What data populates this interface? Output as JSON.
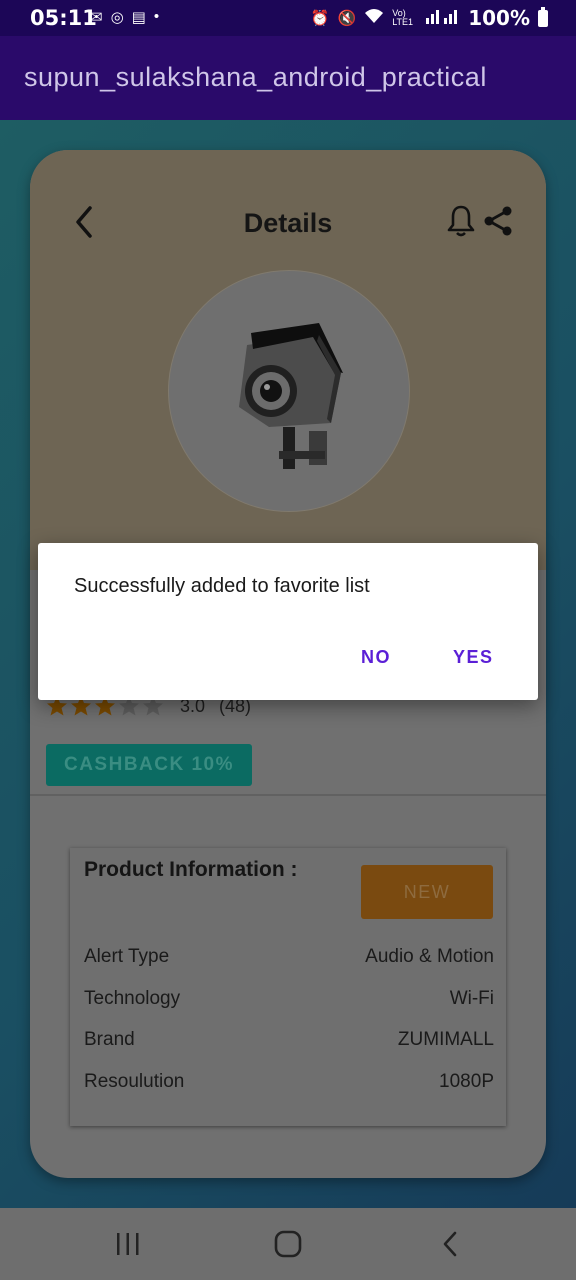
{
  "status_bar": {
    "time": "05:11",
    "battery": "100%",
    "network": "Vo) LTE1"
  },
  "app_bar": {
    "title": "supun_sulakshana_android_practical"
  },
  "details": {
    "title": "Details",
    "rating": {
      "value": "3.0",
      "count": "(48)",
      "stars_filled": 3,
      "stars_total": 5
    },
    "cashback_label": "CASHBACK 10%",
    "product_info": {
      "title": "Product Information :",
      "badge": "NEW",
      "rows": [
        {
          "key": "Alert Type",
          "value": "Audio & Motion"
        },
        {
          "key": "Technology",
          "value": "Wi-Fi"
        },
        {
          "key": "Brand",
          "value": "ZUMIMALL"
        },
        {
          "key": "Resoulution",
          "value": "1080P"
        }
      ]
    }
  },
  "dialog": {
    "message": "Successfully added to favorite list",
    "no_label": "NO",
    "yes_label": "YES"
  },
  "colors": {
    "app_bar": "#2a0a6a",
    "status_bar": "#1c0657",
    "dialog_accent": "#5b1fd6",
    "star_filled": "#7a4a00"
  },
  "icons": [
    "back-arrow-icon",
    "bell-icon",
    "share-icon",
    "star-icon",
    "recent-apps-icon",
    "home-icon",
    "nav-back-icon"
  ]
}
